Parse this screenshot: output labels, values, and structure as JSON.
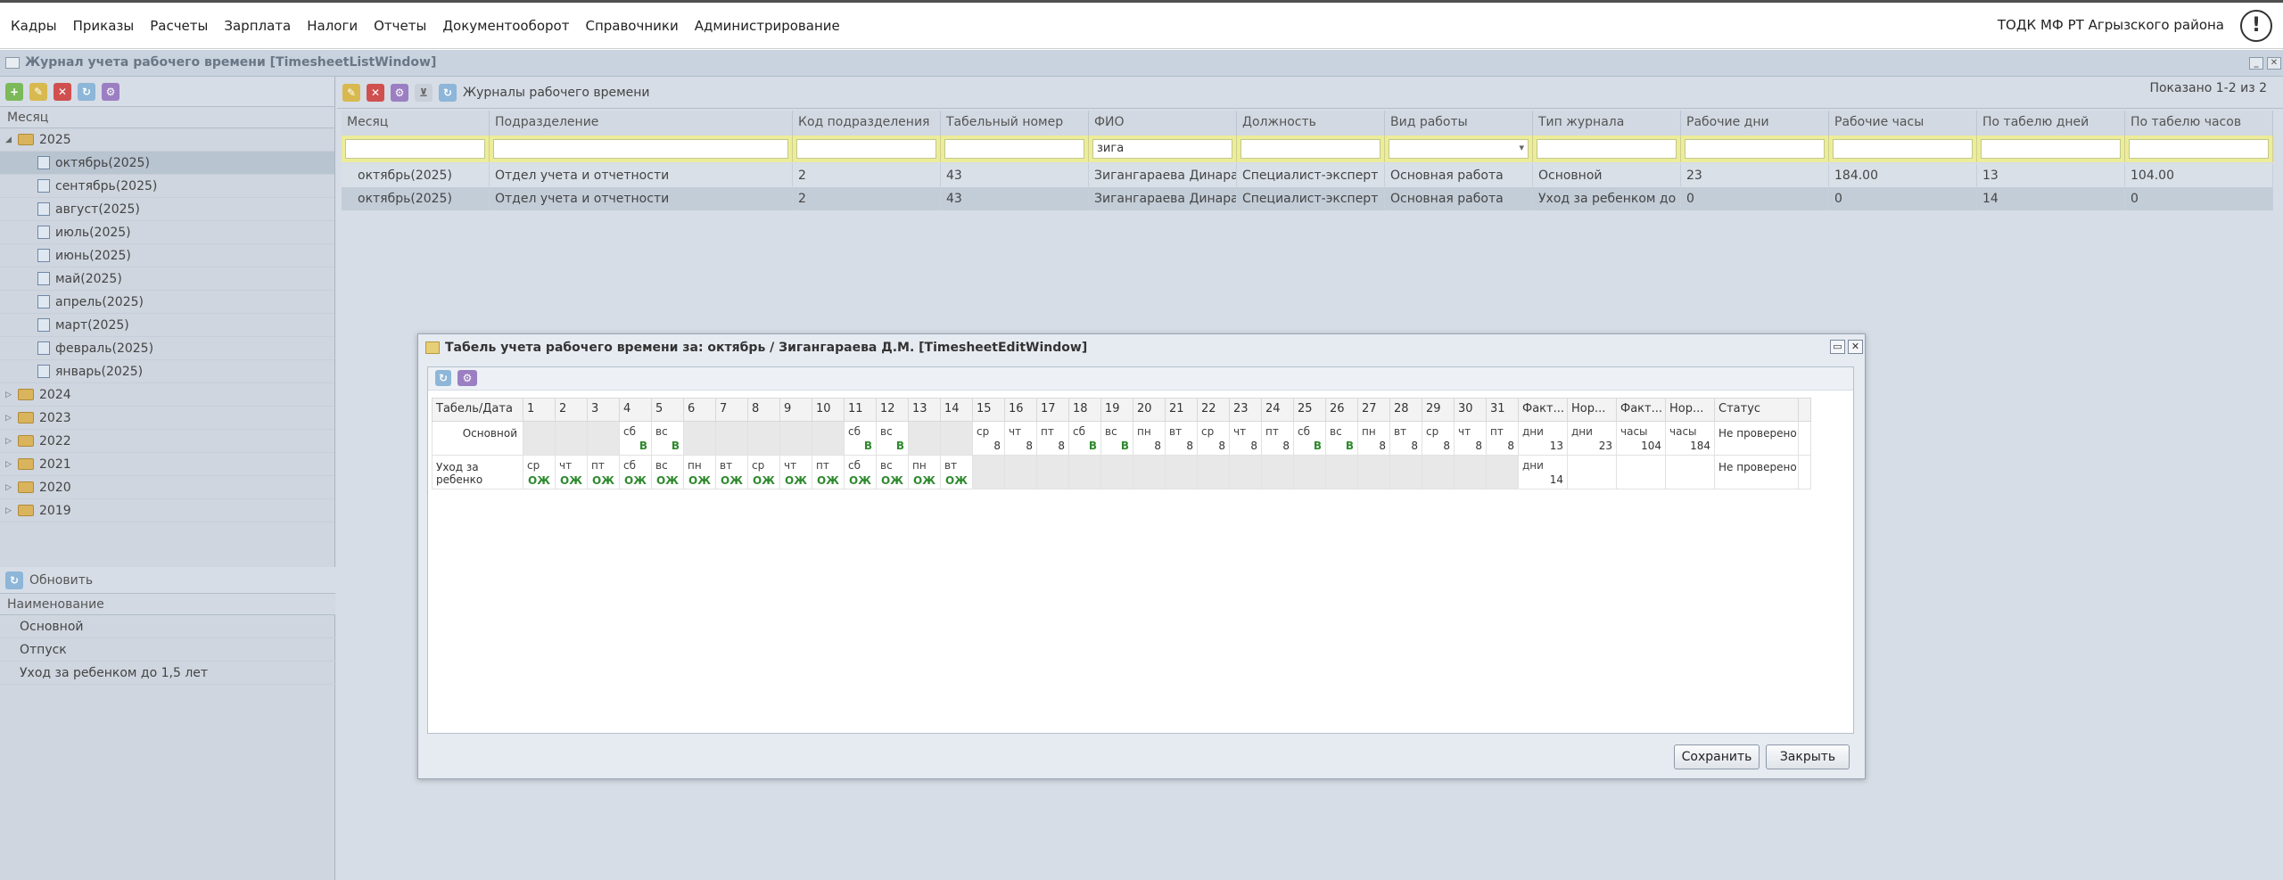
{
  "menu": [
    "Кадры",
    "Приказы",
    "Расчеты",
    "Зарплата",
    "Налоги",
    "Отчеты",
    "Документооборот",
    "Справочники",
    "Администрирование"
  ],
  "org": "ТОДК МФ РТ Агрызского района",
  "alert_icon": "!",
  "window_title": "Журнал учета рабочего времени [TimesheetListWindow]",
  "left": {
    "header": "Месяц",
    "tree": [
      {
        "label": "2025",
        "expanded": true
      },
      {
        "label": "октябрь(2025)",
        "child": true,
        "selected": true
      },
      {
        "label": "сентябрь(2025)",
        "child": true
      },
      {
        "label": "август(2025)",
        "child": true
      },
      {
        "label": "июль(2025)",
        "child": true
      },
      {
        "label": "июнь(2025)",
        "child": true
      },
      {
        "label": "май(2025)",
        "child": true
      },
      {
        "label": "апрель(2025)",
        "child": true
      },
      {
        "label": "март(2025)",
        "child": true
      },
      {
        "label": "февраль(2025)",
        "child": true
      },
      {
        "label": "январь(2025)",
        "child": true
      },
      {
        "label": "2024"
      },
      {
        "label": "2023"
      },
      {
        "label": "2022"
      },
      {
        "label": "2021"
      },
      {
        "label": "2020"
      },
      {
        "label": "2019"
      }
    ],
    "refresh_label": "Обновить",
    "name_header": "Наименование",
    "names": [
      "Основной",
      "Отпуск",
      "Уход за ребенком до 1,5 лет"
    ]
  },
  "right": {
    "toolbar_label": "Журналы рабочего времени",
    "shown": "Показано 1-2 из 2",
    "columns": [
      "Месяц",
      "Подразделение",
      "Код подразделения",
      "Табельный номер",
      "ФИО",
      "Должность",
      "Вид работы",
      "Тип журнала",
      "Рабочие дни",
      "Рабочие часы",
      "По табелю дней",
      "По табелю часов"
    ],
    "filter_fio": "зига",
    "rows": [
      [
        "октябрь(2025)",
        "Отдел учета и отчетности",
        "2",
        "43",
        "Зигангараева Динара ...",
        "Специалист-эксперт",
        "Основная работа",
        "Основной",
        "23",
        "184.00",
        "13",
        "104.00"
      ],
      [
        "октябрь(2025)",
        "Отдел учета и отчетности",
        "2",
        "43",
        "Зигангараева Динара ...",
        "Специалист-эксперт",
        "Основная работа",
        "Уход за ребенком до ...",
        "0",
        "0",
        "14",
        "0"
      ]
    ]
  },
  "modal": {
    "title": "Табель учета рабочего времени за: октябрь / Зигангараева Д.М. [TimesheetEditWindow]",
    "col_first": "Табель/Дата",
    "tail_headers": [
      "Факт...",
      "Нор...",
      "Факт...",
      "Нор...",
      "Статус"
    ],
    "row1": {
      "name": "Основной",
      "days": [
        {
          "g": true
        },
        {
          "g": true
        },
        {
          "g": true
        },
        {
          "t": "сб",
          "v": "В",
          "green": true
        },
        {
          "t": "вс",
          "v": "В",
          "green": true
        },
        {
          "g": true
        },
        {
          "g": true
        },
        {
          "g": true
        },
        {
          "g": true
        },
        {
          "g": true
        },
        {
          "t": "сб",
          "v": "В",
          "green": true
        },
        {
          "t": "вс",
          "v": "В",
          "green": true
        },
        {
          "g": true
        },
        {
          "g": true
        },
        {
          "t": "ср",
          "v": "8"
        },
        {
          "t": "чт",
          "v": "8"
        },
        {
          "t": "пт",
          "v": "8"
        },
        {
          "t": "сб",
          "v": "В",
          "green": true
        },
        {
          "t": "вс",
          "v": "В",
          "green": true
        },
        {
          "t": "пн",
          "v": "8"
        },
        {
          "t": "вт",
          "v": "8"
        },
        {
          "t": "ср",
          "v": "8"
        },
        {
          "t": "чт",
          "v": "8"
        },
        {
          "t": "пт",
          "v": "8"
        },
        {
          "t": "сб",
          "v": "В",
          "green": true
        },
        {
          "t": "вс",
          "v": "В",
          "green": true
        },
        {
          "t": "пн",
          "v": "8"
        },
        {
          "t": "вт",
          "v": "8"
        },
        {
          "t": "ср",
          "v": "8"
        },
        {
          "t": "чт",
          "v": "8"
        },
        {
          "t": "пт",
          "v": "8"
        }
      ],
      "tail": [
        {
          "t": "дни",
          "v": "13"
        },
        {
          "t": "дни",
          "v": "23"
        },
        {
          "t": "часы",
          "v": "104"
        },
        {
          "t": "часы",
          "v": "184"
        }
      ],
      "status": "Не проверено"
    },
    "row2": {
      "name": "Уход за ребенко",
      "days": [
        {
          "t": "ср",
          "oz": "ОЖ"
        },
        {
          "t": "чт",
          "oz": "ОЖ"
        },
        {
          "t": "пт",
          "oz": "ОЖ"
        },
        {
          "t": "сб",
          "oz": "ОЖ"
        },
        {
          "t": "вс",
          "oz": "ОЖ"
        },
        {
          "t": "пн",
          "oz": "ОЖ"
        },
        {
          "t": "вт",
          "oz": "ОЖ"
        },
        {
          "t": "ср",
          "oz": "ОЖ"
        },
        {
          "t": "чт",
          "oz": "ОЖ"
        },
        {
          "t": "пт",
          "oz": "ОЖ"
        },
        {
          "t": "сб",
          "oz": "ОЖ"
        },
        {
          "t": "вс",
          "oz": "ОЖ"
        },
        {
          "t": "пн",
          "oz": "ОЖ"
        },
        {
          "t": "вт",
          "oz": "ОЖ"
        },
        {
          "g": true
        },
        {
          "g": true
        },
        {
          "g": true
        },
        {
          "g": true
        },
        {
          "g": true
        },
        {
          "g": true
        },
        {
          "g": true
        },
        {
          "g": true
        },
        {
          "g": true
        },
        {
          "g": true
        },
        {
          "g": true
        },
        {
          "g": true
        },
        {
          "g": true
        },
        {
          "g": true
        },
        {
          "g": true
        },
        {
          "g": true
        },
        {
          "g": true
        }
      ],
      "tail": [
        {
          "t": "дни",
          "v": "14"
        },
        {},
        {},
        {}
      ],
      "status": "Не проверено"
    },
    "save_label": "Сохранить",
    "close_label": "Закрыть"
  }
}
